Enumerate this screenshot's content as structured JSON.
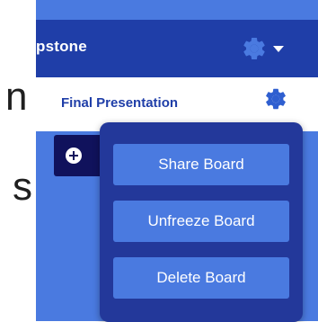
{
  "background": {
    "lines": [
      "n",
      "s:"
    ]
  },
  "header": {
    "board_title": "pstone",
    "settings_icon": "gear-icon",
    "dropdown_icon": "caret-down-icon"
  },
  "subheader": {
    "title": "Final Presentation",
    "settings_icon": "gear-icon"
  },
  "add_button": {
    "icon": "plus-circle-icon"
  },
  "board_menu": {
    "items": [
      "Share Board",
      "Unfreeze Board",
      "Delete Board"
    ]
  },
  "colors": {
    "header_bg": "#1f3ea8",
    "app_bg": "#4a7ae0",
    "menu_bg": "#23389a",
    "menu_item_bg": "#4a7ae0",
    "add_button_bg": "#10125c",
    "gear_top": "#4a7ae0",
    "gear_sub": "#2f5fd0"
  }
}
